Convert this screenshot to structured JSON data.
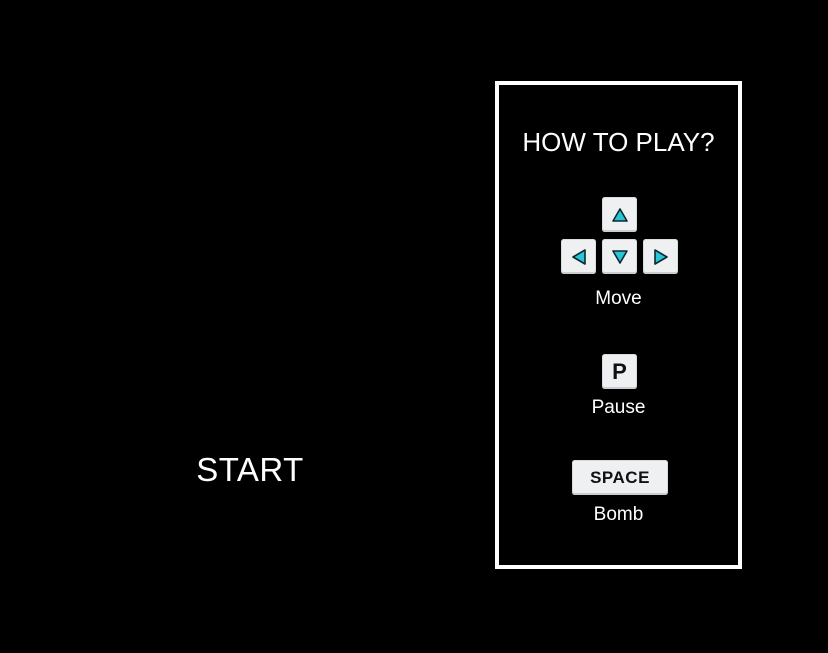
{
  "menu": {
    "start_label": "START"
  },
  "help": {
    "title": "HOW TO PLAY?",
    "move_label": "Move",
    "pause_key": "P",
    "pause_label": "Pause",
    "bomb_key": "SPACE",
    "bomb_label": "Bomb",
    "arrow_icons": [
      "arrow-up-icon",
      "arrow-left-icon",
      "arrow-down-icon",
      "arrow-right-icon"
    ]
  },
  "colors": {
    "background": "#000000",
    "text": "#ffffff",
    "panel_border": "#ffffff",
    "key_face": "#eef0f2",
    "arrow_fill": "#29c4d6",
    "arrow_outline": "#0a2a30"
  }
}
